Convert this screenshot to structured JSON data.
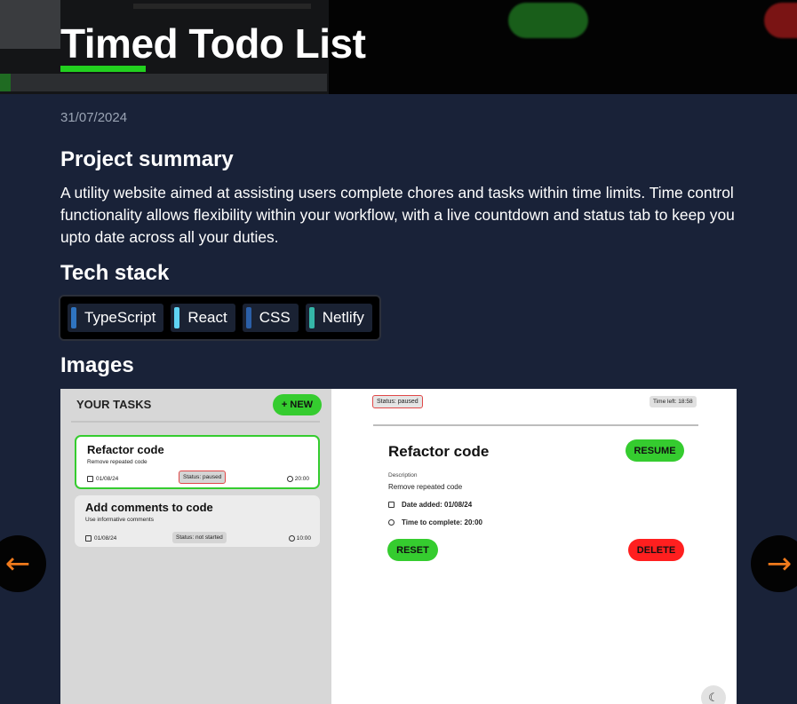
{
  "project": {
    "title": "Timed Todo List",
    "date": "31/07/2024"
  },
  "sections": {
    "summary_heading": "Project summary",
    "summary_text": "A utility website aimed at assisting users complete chores and tasks within time limits. Time control functionality allows flexibility within your workflow, with a live countdown and status tab to keep you upto date across all your duties.",
    "tech_heading": "Tech stack",
    "images_heading": "Images"
  },
  "tech_stack": [
    {
      "label": "TypeScript",
      "color": "#2f74c0"
    },
    {
      "label": "React",
      "color": "#5fd3f3"
    },
    {
      "label": "CSS",
      "color": "#2b5fa8"
    },
    {
      "label": "Netlify",
      "color": "#35b6a8"
    }
  ],
  "gallery": {
    "prev_icon": "←",
    "next_icon": "→",
    "screenshot": {
      "tasks_heading": "YOUR TASKS",
      "new_button": "+ NEW",
      "tasks": [
        {
          "title": "Refactor code",
          "subtitle": "Remove repeated code",
          "date": "01/08/24",
          "status": "Status: paused",
          "time": "20:00"
        },
        {
          "title": "Add comments to code",
          "subtitle": "Use informative comments",
          "date": "01/08/24",
          "status": "Status: not started",
          "time": "10:00"
        }
      ],
      "detail": {
        "status": "Status: paused",
        "time_left": "Time left: 18:58",
        "title": "Refactor code",
        "resume_button": "RESUME",
        "description_label": "Description",
        "description": "Remove repeated code",
        "date_added": "Date added: 01/08/24",
        "time_to_complete": "Time to complete: 20:00",
        "reset_button": "RESET",
        "delete_button": "DELETE"
      },
      "theme_icon": "☾"
    }
  },
  "colors": {
    "page_bg": "#192238",
    "accent_green": "#22d01f",
    "arrow_orange": "#f07a1c",
    "delete_red": "#ff1f1f"
  }
}
